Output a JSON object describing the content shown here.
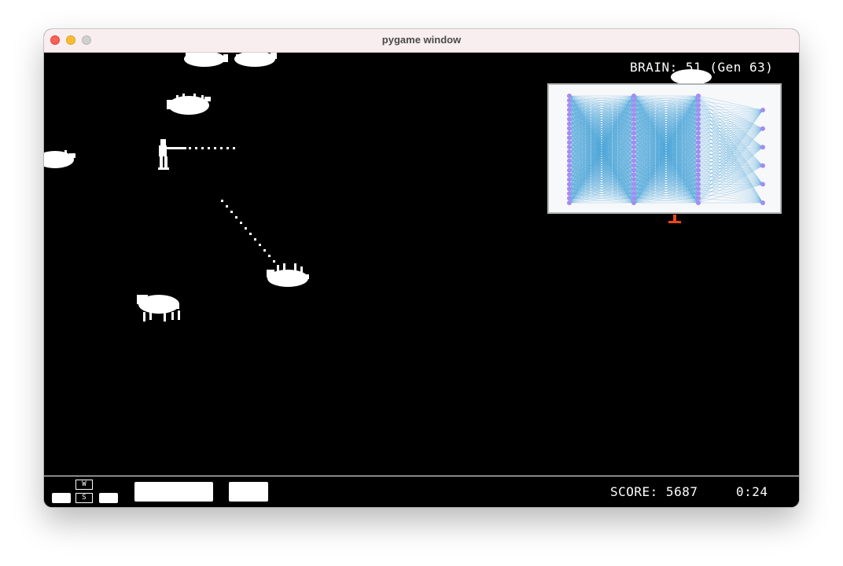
{
  "window": {
    "title": "pygame window"
  },
  "hud": {
    "brain_label": "BRAIN: 51 (Gen 63)",
    "score_label": "SCORE: 5687",
    "timer": "0:24",
    "keys": {
      "up": "W",
      "down": "S"
    }
  },
  "neural_net": {
    "layers": [
      24,
      24,
      24,
      6
    ],
    "node_color": "#a48cf2",
    "edge_color": "#3f9ed6"
  },
  "colors": {
    "background": "#000000",
    "sprites": "#ffffff",
    "hunter_feet_marker": "#e8481c"
  }
}
